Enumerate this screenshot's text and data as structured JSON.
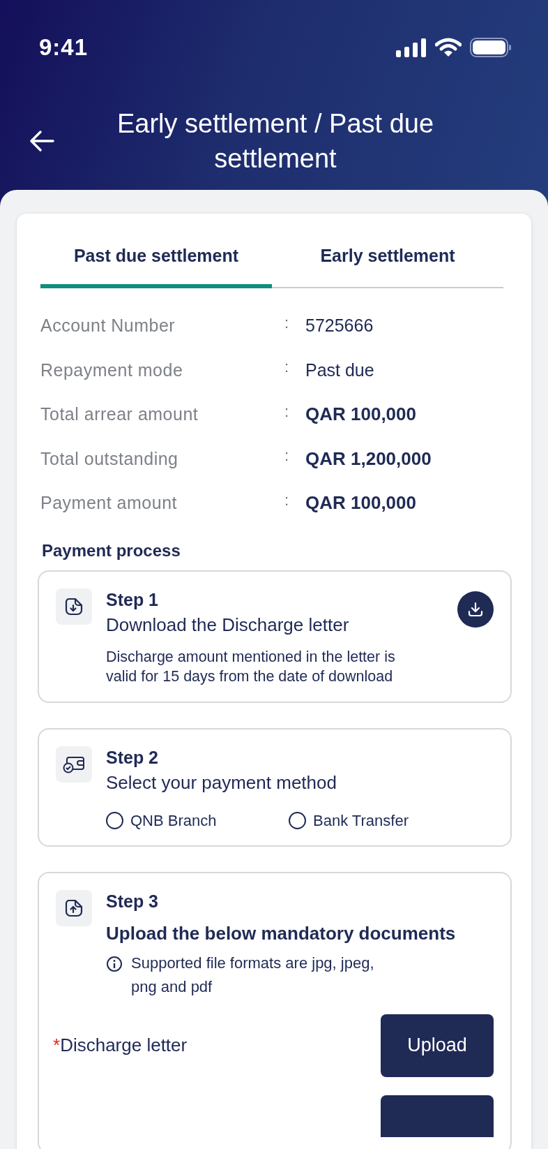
{
  "status_bar": {
    "time": "9:41"
  },
  "header": {
    "title": "Early settlement / Past due settlement"
  },
  "tabs": [
    {
      "label": "Past due settlement",
      "selected": true
    },
    {
      "label": "Early settlement",
      "selected": false
    }
  ],
  "details": [
    {
      "label": "Account Number",
      "separator": ":",
      "value": "5725666",
      "kind": "plain"
    },
    {
      "label": "Repayment mode",
      "separator": ":",
      "value": "Past due",
      "kind": "plain"
    },
    {
      "label": "Total arrear amount",
      "separator": ":",
      "value": "QAR 100,000",
      "kind": "amount"
    },
    {
      "label": "Total outstanding",
      "separator": ":",
      "value": "QAR 1,200,000",
      "kind": "amount"
    },
    {
      "label": "Payment amount",
      "separator": ":",
      "value": "QAR 100,000",
      "kind": "amount"
    }
  ],
  "payment_process": {
    "title": "Payment process",
    "steps": [
      {
        "kind": "download",
        "step": "Step 1",
        "title": "Download the Discharge letter",
        "note": "Discharge amount mentioned in the letter is valid for 15 days from the date of download"
      },
      {
        "kind": "payment",
        "step": "Step 2",
        "title": "Select your payment method",
        "options": [
          {
            "label": "QNB Branch",
            "selected": false
          },
          {
            "label": "Bank Transfer",
            "selected": false
          }
        ]
      },
      {
        "kind": "upload",
        "step": "Step 3",
        "title": "Upload the below mandatory documents",
        "info": "Supported file formats are jpg, jpeg, png and pdf",
        "documents": [
          {
            "required_mark": "*",
            "label": "Discharge letter",
            "button": "Upload"
          }
        ]
      }
    ]
  }
}
